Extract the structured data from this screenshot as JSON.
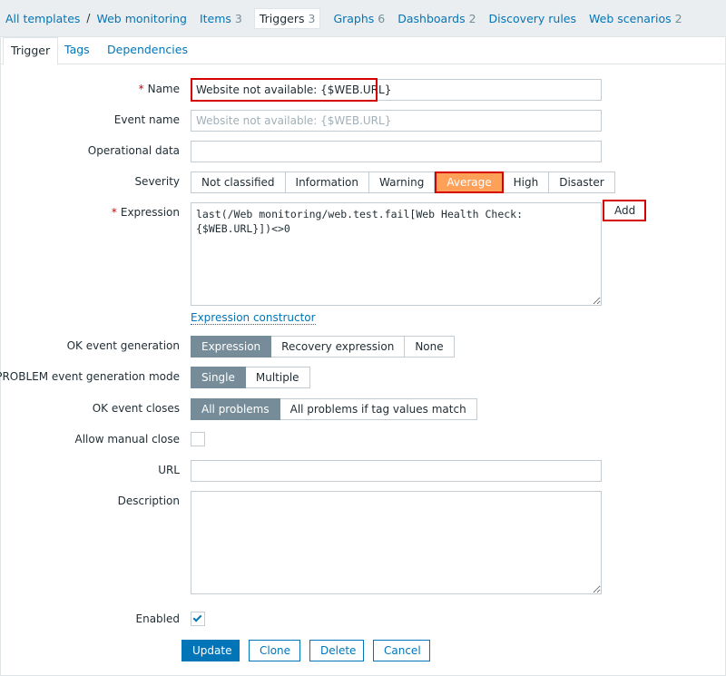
{
  "nav": {
    "all_templates": "All templates",
    "template_name": "Web monitoring",
    "items": {
      "label": "Items",
      "count": "3"
    },
    "triggers": {
      "label": "Triggers",
      "count": "3"
    },
    "graphs": {
      "label": "Graphs",
      "count": "6"
    },
    "dashboards": {
      "label": "Dashboards",
      "count": "2"
    },
    "discovery": {
      "label": "Discovery rules"
    },
    "web_scenarios": {
      "label": "Web scenarios",
      "count": "2"
    }
  },
  "tabs": [
    "Trigger",
    "Tags",
    "Dependencies"
  ],
  "form": {
    "name": {
      "label": "Name",
      "required": "*",
      "value": "Website not available: {$WEB.URL}"
    },
    "event_name": {
      "label": "Event name",
      "placeholder": "Website not available: {$WEB.URL}"
    },
    "operational_data": {
      "label": "Operational data",
      "value": ""
    },
    "severity": {
      "label": "Severity",
      "options": [
        "Not classified",
        "Information",
        "Warning",
        "Average",
        "High",
        "Disaster"
      ],
      "selected": "Average"
    },
    "expression": {
      "label": "Expression",
      "required": "*",
      "value": "last(/Web monitoring/web.test.fail[Web Health Check:{$WEB.URL}])<>0",
      "add_button": "Add",
      "constructor_link": "Expression constructor"
    },
    "ok_event_generation": {
      "label": "OK event generation",
      "options": [
        "Expression",
        "Recovery expression",
        "None"
      ],
      "selected": "Expression"
    },
    "problem_mode": {
      "label": "PROBLEM event generation mode",
      "options": [
        "Single",
        "Multiple"
      ],
      "selected": "Single"
    },
    "ok_event_closes": {
      "label": "OK event closes",
      "options": [
        "All problems",
        "All problems if tag values match"
      ],
      "selected": "All problems"
    },
    "allow_manual_close": {
      "label": "Allow manual close",
      "checked": false
    },
    "url": {
      "label": "URL",
      "value": ""
    },
    "description": {
      "label": "Description",
      "value": ""
    },
    "enabled": {
      "label": "Enabled",
      "checked": true
    }
  },
  "buttons": {
    "update": "Update",
    "clone": "Clone",
    "delete": "Delete",
    "cancel": "Cancel"
  },
  "colors": {
    "accent": "#0275b8",
    "average_severity": "#ffa059",
    "selected_segment": "#768d99",
    "highlight": "#d40000"
  }
}
